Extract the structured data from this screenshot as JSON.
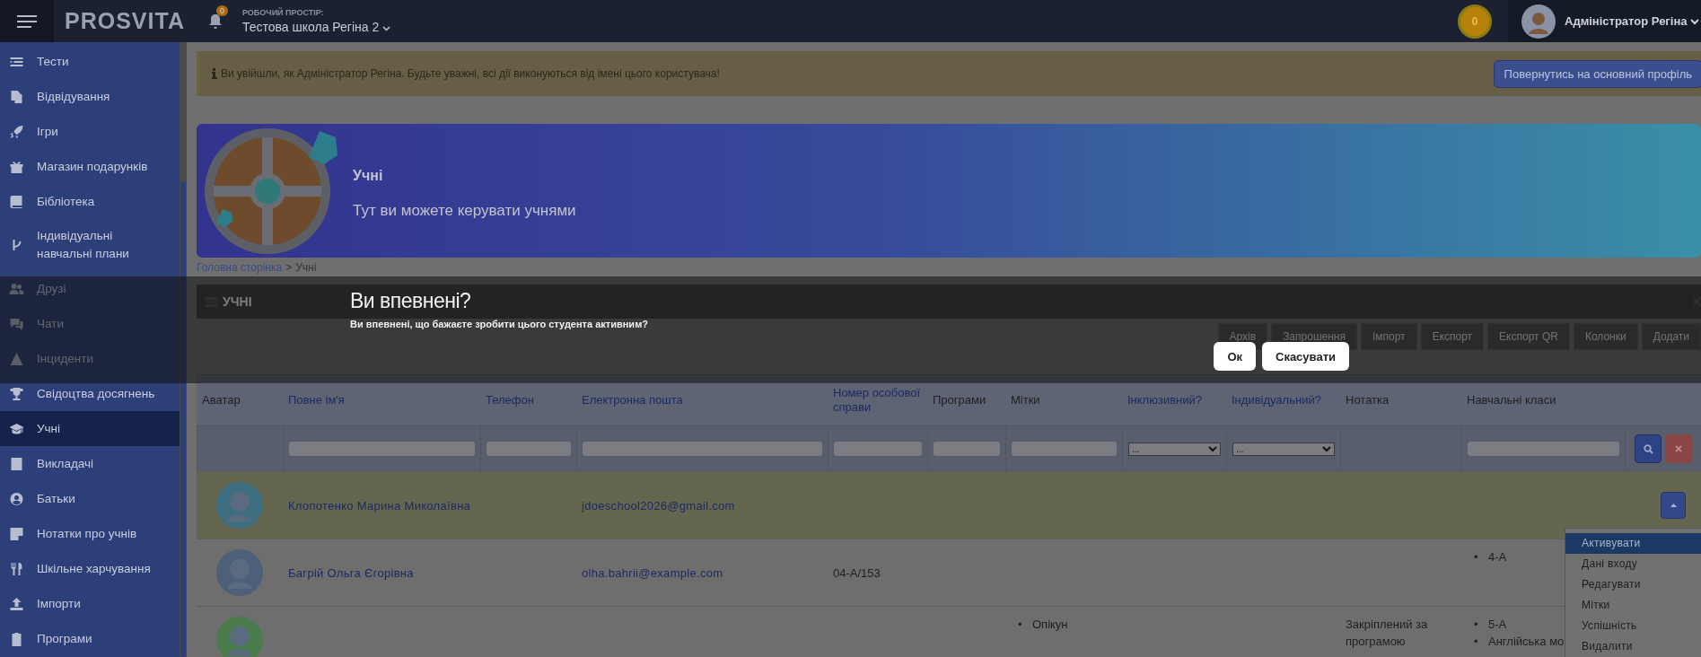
{
  "top_bar": {
    "logo": "PROSVITA",
    "notifications_badge": "0",
    "workspace_label": "РОБОЧИЙ ПРОСТІР:",
    "workspace_name": "Тестова школа Регіна 2",
    "coins": "0",
    "user_name": "Адміністратор Регіна"
  },
  "sidebar": {
    "items": [
      {
        "label": "Тести",
        "selected": false
      },
      {
        "label": "Відвідування",
        "selected": false
      },
      {
        "label": "Ігри",
        "selected": false
      },
      {
        "label": "Магазин подарунків",
        "selected": false
      },
      {
        "label": "Бібліотека",
        "selected": false
      },
      {
        "label": "Індивідуальні навчальні плани",
        "selected": false
      },
      {
        "label": "Друзі",
        "selected": false
      },
      {
        "label": "Чати",
        "selected": false
      },
      {
        "label": "Інциденти",
        "selected": false
      },
      {
        "label": "Свідоцтва досягнень",
        "selected": false
      },
      {
        "label": "Учні",
        "selected": true
      },
      {
        "label": "Викладачі",
        "selected": false
      },
      {
        "label": "Батьки",
        "selected": false
      },
      {
        "label": "Нотатки про учнів",
        "selected": false
      },
      {
        "label": "Шкільне харчування",
        "selected": false
      },
      {
        "label": "Імпорти",
        "selected": false
      },
      {
        "label": "Програми",
        "selected": false
      }
    ]
  },
  "alert": {
    "text": "Ви увійшли, як Адміністратор Регіна. Будьте уважні, всі дії виконуються від імені цього користувача!",
    "button": "Повернутись на основний профіль"
  },
  "banner": {
    "title": "Учні",
    "subtitle": "Тут ви можете керувати учнями"
  },
  "breadcrumb": {
    "home": "Головна сторінка",
    "separator": ">",
    "current": "Учні"
  },
  "panel": {
    "title": "УЧНІ",
    "toolbar": [
      "Архів",
      "Запрошення",
      "Імпорт",
      "Експорт",
      "Експорт QR",
      "Колонки",
      "Додати"
    ]
  },
  "table": {
    "columns": [
      {
        "label": "Аватар",
        "sortable": false,
        "filter_field": false
      },
      {
        "label": "Повне ім'я",
        "sortable": true,
        "filter_field": true
      },
      {
        "label": "Телефон",
        "sortable": true,
        "filter_field": true
      },
      {
        "label": "Електронна пошта",
        "sortable": true,
        "filter_field": true
      },
      {
        "label": "Номер особової справи",
        "sortable": true,
        "filter_field": true
      },
      {
        "label": "Програми",
        "sortable": false,
        "filter_field": true
      },
      {
        "label": "Мітки",
        "sortable": false,
        "filter_field": true
      },
      {
        "label": "Інклюзивний?",
        "sortable": true,
        "filter_field": false,
        "placeholder": "..."
      },
      {
        "label": "Індивідуальний?",
        "sortable": true,
        "filter_field": false,
        "placeholder": "..."
      },
      {
        "label": "Нотатка",
        "sortable": false,
        "filter_field": false
      },
      {
        "label": "Навчальні класи",
        "sortable": false,
        "filter_field": true
      }
    ],
    "list_marker": "•",
    "rows": [
      {
        "highlighted": true,
        "name": "Клопотенко Марина Миколаївна",
        "email": "jdoeschool2026@gmail.com",
        "menu": [
          {
            "label": "Активувати",
            "selected": true
          },
          {
            "label": "Дані входу",
            "selected": false
          },
          {
            "label": "Редагувати",
            "selected": false
          },
          {
            "label": "Мітки",
            "selected": false
          },
          {
            "label": "Успішність",
            "selected": false
          },
          {
            "label": "Видалити",
            "selected": false
          }
        ]
      },
      {
        "highlighted": false,
        "name": "Багрій Ольга Єгорівна",
        "email": "olha.bahrii@example.com",
        "number": "04-А/153",
        "classes": [
          "4-А"
        ]
      },
      {
        "highlighted": false,
        "tags": [
          "Опікун"
        ],
        "note": "Закріплений за програмою",
        "classes": [
          "5-А",
          "Англійська мо"
        ]
      }
    ]
  },
  "dialog": {
    "title": "Ви впевнені?",
    "message": "Ви впевнені, що бажаєте зробити цього студента активним?",
    "buttons": [
      "Ок",
      "Скасувати"
    ]
  }
}
